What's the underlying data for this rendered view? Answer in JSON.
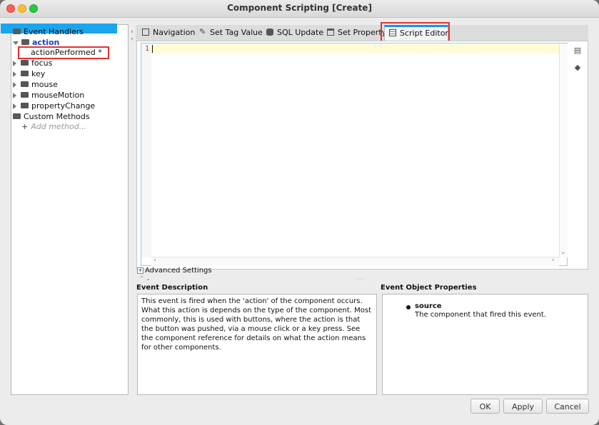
{
  "window": {
    "title": "Component Scripting [Create]"
  },
  "tree": {
    "event_handlers_label": "Event Handlers",
    "action_label": "action",
    "selected_item_label": "actionPerformed *",
    "items": [
      "focus",
      "key",
      "mouse",
      "mouseMotion",
      "propertyChange"
    ],
    "custom_methods_label": "Custom Methods",
    "add_method_label": "Add method..."
  },
  "tabs": [
    {
      "label": "Navigation",
      "icon": "navigation-icon"
    },
    {
      "label": "Set Tag Value",
      "icon": "wrench-icon"
    },
    {
      "label": "SQL Update",
      "icon": "database-icon"
    },
    {
      "label": "Set Property",
      "icon": "property-icon"
    },
    {
      "label": "Script Editor",
      "icon": "script-icon",
      "active": true
    }
  ],
  "editor": {
    "line_number": "1"
  },
  "advanced_settings_label": "Advanced Settings",
  "event_description": {
    "header": "Event Description",
    "text": "This event is fired when the 'action' of the component occurs. What this action is depends on the type of the component. Most commonly, this is used with buttons, where the action is that the button was pushed, via a mouse click or a key press. See the component reference for details on what the action means for other components."
  },
  "event_object_properties": {
    "header": "Event Object Properties",
    "property_name": "source",
    "property_desc": "The component that fired this event."
  },
  "buttons": {
    "ok": "OK",
    "apply": "Apply",
    "cancel": "Cancel"
  },
  "colors": {
    "selection": "#1aa6ee",
    "highlight_box": "#e53030",
    "active_tab_accent": "#1e8ff0"
  }
}
